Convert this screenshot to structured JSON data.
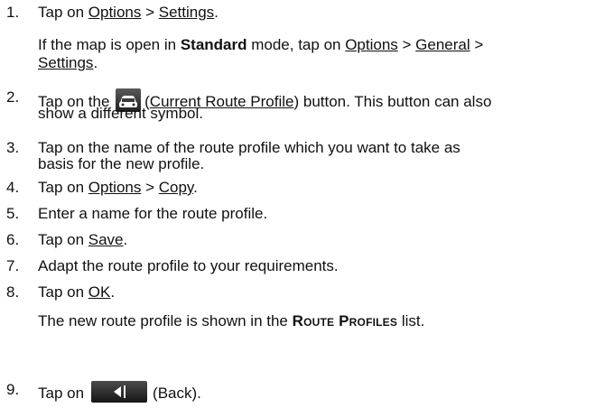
{
  "steps": [
    {
      "number": "1.",
      "line1": {
        "t1": "Tap on ",
        "options": "Options",
        "sep": " > ",
        "settings": "Settings",
        "end": "."
      },
      "sub": {
        "t1": "If the map is open in ",
        "bold": "Standard",
        "t2": " mode, tap on ",
        "options": "Options",
        "sep1": " > ",
        "general": "General",
        "sep2": " >",
        "settings": "Settings",
        "end": "."
      }
    },
    {
      "number": "2.",
      "t1": "Tap on the ",
      "icon": "car-icon",
      "paren_open": "(",
      "link": "Current Route Profile",
      "t2": ") button. This button can also",
      "line2": "show a different symbol."
    },
    {
      "number": "3.",
      "line1": "Tap on the name of the route profile which you want to take as",
      "line2": "basis for the new profile."
    },
    {
      "number": "4.",
      "t1": "Tap on ",
      "options": "Options",
      "sep": " > ",
      "copy": "Copy",
      "end": "."
    },
    {
      "number": "5.",
      "text": "Enter a name for the route profile."
    },
    {
      "number": "6.",
      "t1": "Tap on ",
      "save": "Save",
      "end": "."
    },
    {
      "number": "7.",
      "text": "Adapt the route profile to your requirements."
    },
    {
      "number": "8.",
      "t1": "Tap on ",
      "ok": "OK",
      "end": ".",
      "sub": {
        "t1": "The new route profile is shown in the ",
        "list": "Route Profiles",
        "t2": " list."
      }
    },
    {
      "number": "9.",
      "t1": "Tap on",
      "icon": "back-arrow-icon",
      "t2": "(Back)."
    }
  ]
}
